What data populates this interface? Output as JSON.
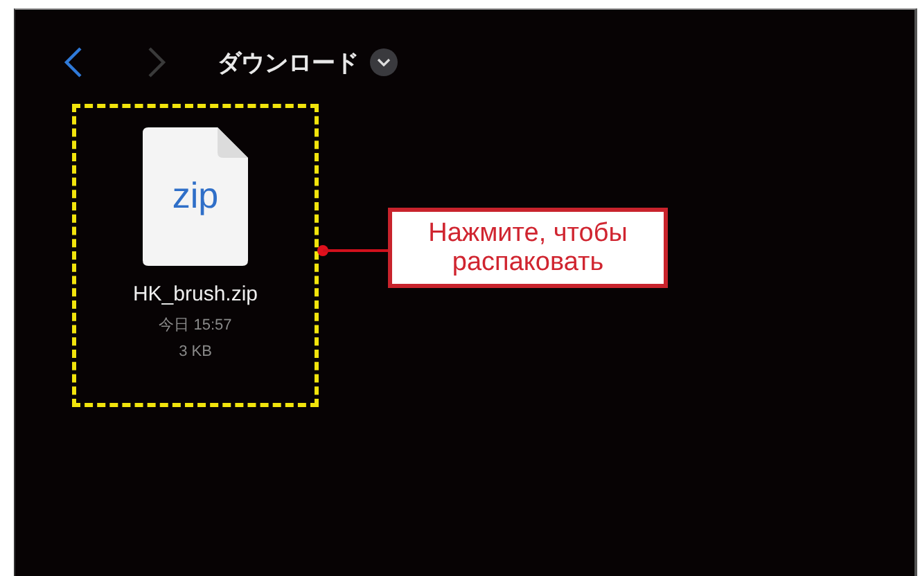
{
  "nav": {
    "buttons": [
      {
        "kind": "back",
        "disabled": false
      },
      {
        "kind": "forward",
        "disabled": true
      }
    ],
    "title": "ダウンロード"
  },
  "files": [
    {
      "icon_label": "zip",
      "name": "HK_brush.zip",
      "date": "今日 15:57",
      "size": "3 KB",
      "highlighted": true
    }
  ],
  "callout": {
    "text": "Нажмите, чтобы распаковать"
  }
}
